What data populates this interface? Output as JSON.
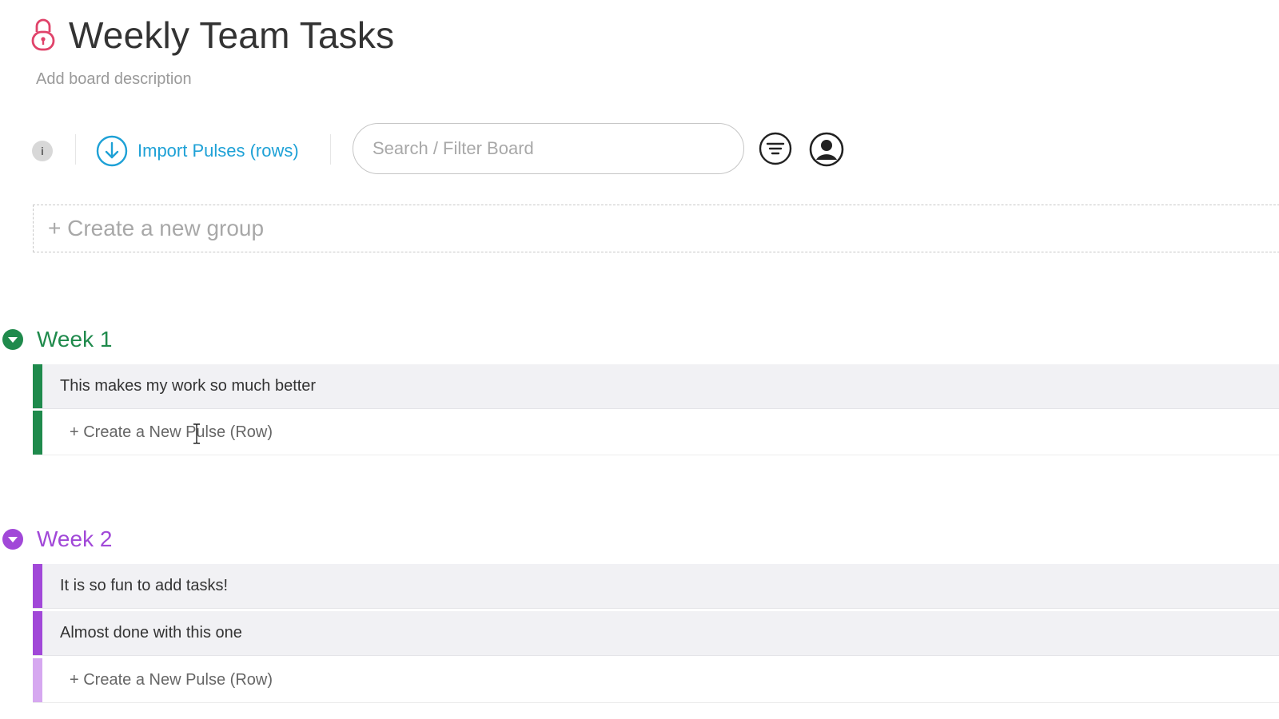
{
  "board": {
    "title": "Weekly Team Tasks",
    "description_placeholder": "Add board description"
  },
  "toolbar": {
    "info_label": "i",
    "import_label": "Import Pulses (rows)",
    "search_placeholder": "Search / Filter Board"
  },
  "new_group_label": "+ Create a new group",
  "groups": [
    {
      "title": "Week 1",
      "color": "#1f8a4c",
      "items": [
        {
          "label": "This makes my work so much better"
        }
      ],
      "add_label": "+ Create a New Pulse (Row)"
    },
    {
      "title": "Week 2",
      "color": "#a148d8",
      "items": [
        {
          "label": "It is so fun to add tasks!"
        },
        {
          "label": "Almost done with this one"
        }
      ],
      "add_label": "+ Create a New Pulse (Row)"
    }
  ],
  "colors": {
    "accent_blue": "#1ea1d6",
    "lock_pink": "#e0436a",
    "week1_green": "#1f8a4c",
    "week2_purple": "#a148d8",
    "week2_add_bar": "#d6a8f0"
  },
  "icons": [
    "lock-icon",
    "info-icon",
    "download-icon",
    "filter-icon",
    "person-icon",
    "chevron-down-icon"
  ]
}
